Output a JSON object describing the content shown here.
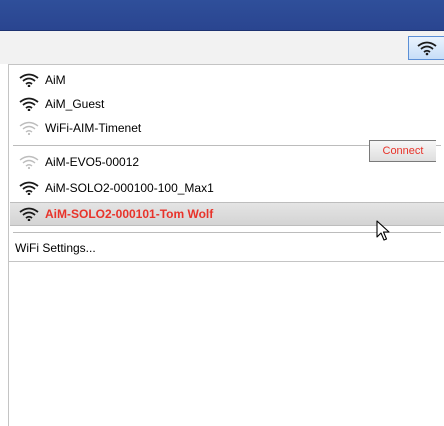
{
  "colors": {
    "titlebar": "#2f4f9a",
    "selected_text": "#e8332a",
    "signal_strong": "#1a1a1a",
    "signal_weak": "#b8b8b8"
  },
  "tray": {
    "icon": "wifi-icon"
  },
  "networks_group1": [
    {
      "label": "AiM",
      "signal": "strong"
    },
    {
      "label": "AiM_Guest",
      "signal": "strong"
    },
    {
      "label": "WiFi-AIM-Timenet",
      "signal": "weak"
    }
  ],
  "networks_group2": [
    {
      "label": "AiM-EVO5-00012",
      "signal": "weak"
    },
    {
      "label": "AiM-SOLO2-000100-100_Max1",
      "signal": "strong"
    },
    {
      "label": "AiM-SOLO2-000101-Tom Wolf",
      "signal": "strong",
      "selected": true
    }
  ],
  "connect_label": "Connect",
  "settings_label": "WiFi Settings..."
}
